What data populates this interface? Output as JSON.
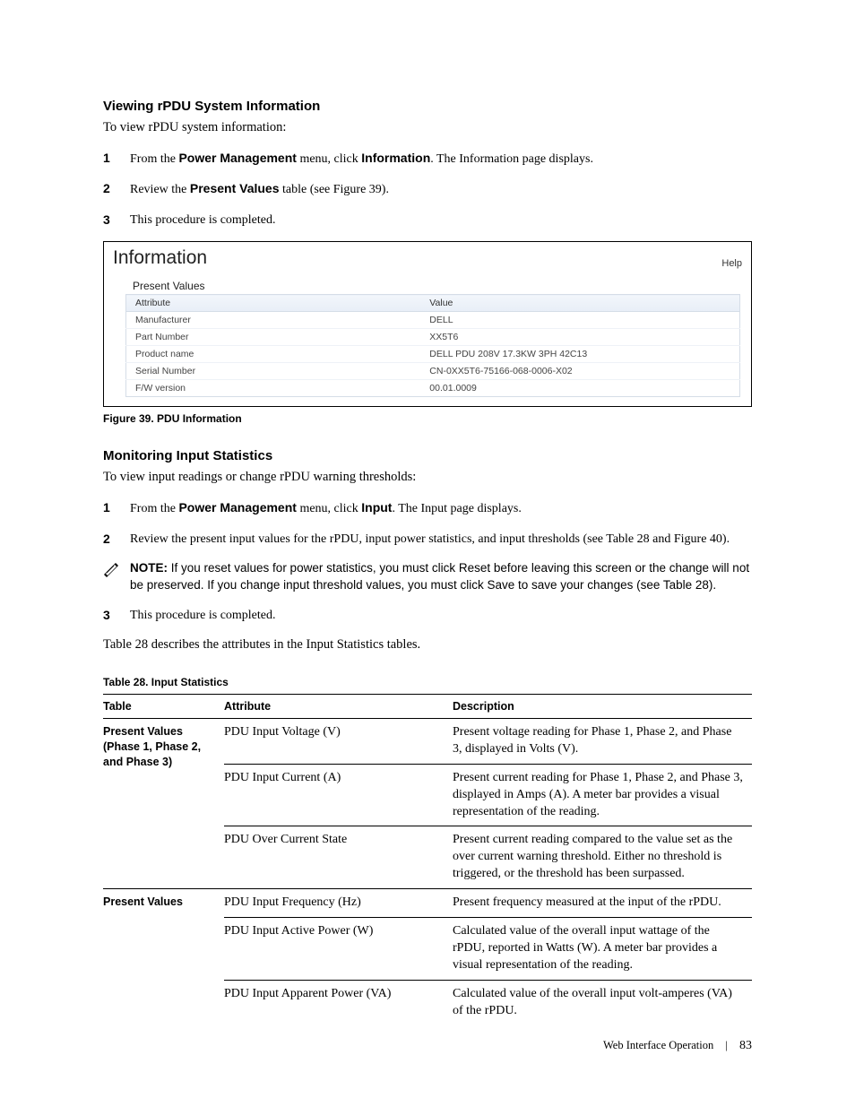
{
  "section1": {
    "heading": "Viewing rPDU System Information",
    "intro": "To view rPDU system information:",
    "steps": [
      {
        "num": "1",
        "pre": "From the ",
        "b1": "Power Management",
        "mid": " menu, click ",
        "b2": "Information",
        "post": ". The Information page displays."
      },
      {
        "num": "2",
        "pre": "Review the ",
        "b1": "Present Values",
        "mid": " table (see Figure 39).",
        "b2": "",
        "post": ""
      },
      {
        "num": "3",
        "pre": "This procedure is completed.",
        "b1": "",
        "mid": "",
        "b2": "",
        "post": ""
      }
    ]
  },
  "screenshot": {
    "title": "Information",
    "help": "Help",
    "section": "Present Values",
    "headers": {
      "attr": "Attribute",
      "val": "Value"
    },
    "rows": [
      {
        "attr": "Manufacturer",
        "val": "DELL"
      },
      {
        "attr": "Part Number",
        "val": "XX5T6"
      },
      {
        "attr": "Product name",
        "val": "DELL PDU 208V 17.3KW 3PH 42C13"
      },
      {
        "attr": "Serial Number",
        "val": "CN-0XX5T6-75166-068-0006-X02"
      },
      {
        "attr": "F/W version",
        "val": "00.01.0009"
      }
    ],
    "caption": "Figure 39. PDU Information"
  },
  "section2": {
    "heading": "Monitoring Input Statistics",
    "intro": "To view input readings or change rPDU warning thresholds:",
    "steps": [
      {
        "num": "1",
        "pre": "From the ",
        "b1": "Power Management",
        "mid": " menu, click ",
        "b2": "Input",
        "post": ". The Input page displays."
      },
      {
        "num": "2",
        "pre": "Review the present input values for the rPDU, input power statistics, and input thresholds (see Table 28 and Figure 40).",
        "b1": "",
        "mid": "",
        "b2": "",
        "post": ""
      }
    ],
    "note": {
      "label": "NOTE: ",
      "t1": "If you reset values for power statistics, you must click ",
      "r1": "Reset",
      "t2": " before leaving this screen or the change will not be preserved. If you change input threshold values, you must click ",
      "r2": "Save",
      "t3": " to save your changes (see Table 28)."
    },
    "step3": {
      "num": "3",
      "text": "This procedure is completed."
    },
    "lead_out": "Table 28 describes the attributes in the Input Statistics tables."
  },
  "table28": {
    "caption": "Table 28. Input Statistics",
    "headers": {
      "c1": "Table",
      "c2": "Attribute",
      "c3": "Description"
    },
    "group1_label": "Present Values (Phase 1, Phase 2, and Phase 3)",
    "group1": [
      {
        "attr": "PDU Input Voltage (V)",
        "desc": "Present voltage reading for Phase 1, Phase 2, and Phase 3, displayed in Volts (V)."
      },
      {
        "attr": "PDU Input Current (A)",
        "desc": "Present current reading for Phase 1, Phase 2, and Phase 3, displayed in Amps (A). A meter bar provides a visual representation of the reading."
      },
      {
        "attr": "PDU Over Current State",
        "desc": "Present current reading compared to the value set as the over current warning threshold. Either no threshold is triggered, or the threshold has been surpassed."
      }
    ],
    "group2_label": "Present Values",
    "group2": [
      {
        "attr": "PDU Input Frequency (Hz)",
        "desc": "Present frequency measured at the input of the rPDU."
      },
      {
        "attr": "PDU Input Active Power (W)",
        "desc": "Calculated value of the overall input wattage of the rPDU, reported in Watts (W). A meter bar provides a visual representation of the reading."
      },
      {
        "attr": "PDU Input Apparent Power (VA)",
        "desc": "Calculated value of the overall input volt-amperes (VA) of the rPDU."
      }
    ]
  },
  "footer": {
    "section": "Web Interface Operation",
    "page": "83"
  }
}
